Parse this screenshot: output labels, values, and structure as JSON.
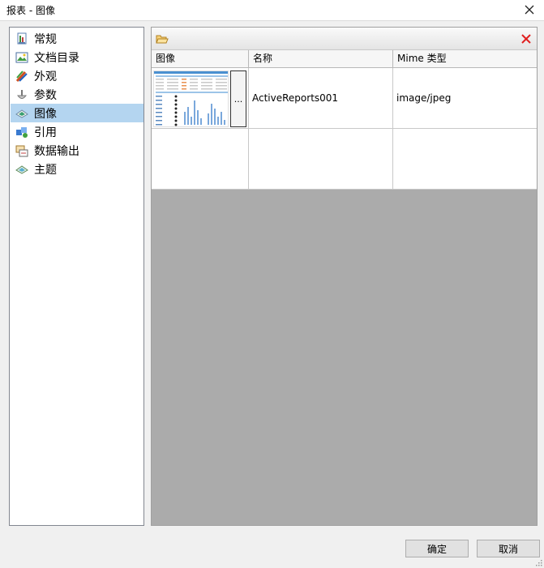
{
  "window": {
    "title": "报表 - 图像"
  },
  "nav": {
    "items": [
      {
        "label": "常规",
        "icon": "general-icon",
        "selected": false
      },
      {
        "label": "文档目录",
        "icon": "document-map-icon",
        "selected": false
      },
      {
        "label": "外观",
        "icon": "appearance-icon",
        "selected": false
      },
      {
        "label": "参数",
        "icon": "parameters-icon",
        "selected": false
      },
      {
        "label": "图像",
        "icon": "images-icon",
        "selected": true
      },
      {
        "label": "引用",
        "icon": "references-icon",
        "selected": false
      },
      {
        "label": "数据输出",
        "icon": "data-output-icon",
        "selected": false
      },
      {
        "label": "主题",
        "icon": "themes-icon",
        "selected": false
      }
    ]
  },
  "images_grid": {
    "columns": [
      "图像",
      "名称",
      "Mime 类型"
    ],
    "rows": [
      {
        "name": "ActiveReports001",
        "mime": "image/jpeg",
        "browse_label": "..."
      }
    ]
  },
  "footer": {
    "ok_label": "确定",
    "cancel_label": "取消"
  },
  "colors": {
    "selection": "#b4d5f0",
    "empty_area": "#ababab",
    "delete": "#e02020",
    "folder": "#e8b43a"
  }
}
